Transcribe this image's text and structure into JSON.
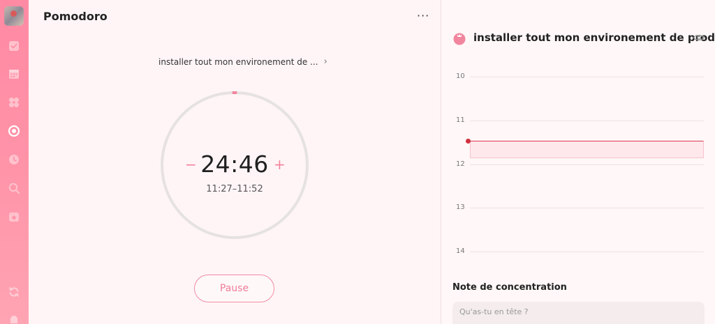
{
  "sidebar": {
    "items": [
      {
        "icon": "checkbox-icon",
        "active": false
      },
      {
        "icon": "calendar-icon",
        "active": false
      },
      {
        "icon": "matrix-icon",
        "active": false
      },
      {
        "icon": "pomodoro-icon",
        "active": true
      },
      {
        "icon": "clock-icon",
        "active": false
      },
      {
        "icon": "search-icon",
        "active": false
      },
      {
        "icon": "habit-icon",
        "active": false
      }
    ],
    "bottom": [
      {
        "icon": "sync-icon"
      },
      {
        "icon": "notification-icon"
      }
    ]
  },
  "main": {
    "title": "Pomodoro",
    "more": "···",
    "task_name": "installer tout mon environement de ...",
    "timer": {
      "display": "24:46",
      "range": "11:27–11:52",
      "minus": "−",
      "plus": "+",
      "progress_fraction": 0.01
    },
    "pause_label": "Pause"
  },
  "detail": {
    "task_title": "installer tout mon environement de prod",
    "timeline": {
      "hours": [
        "10",
        "11",
        "12",
        "13",
        "14"
      ],
      "session": {
        "start": "11:27",
        "end": "11:52"
      }
    },
    "note_title": "Note de concentration",
    "note_placeholder": "Qu'as-tu en tête ?"
  },
  "colors": {
    "accent": "#f2859e",
    "sidebar": "#ff93a8",
    "timeline_marker": "#d0303e"
  }
}
